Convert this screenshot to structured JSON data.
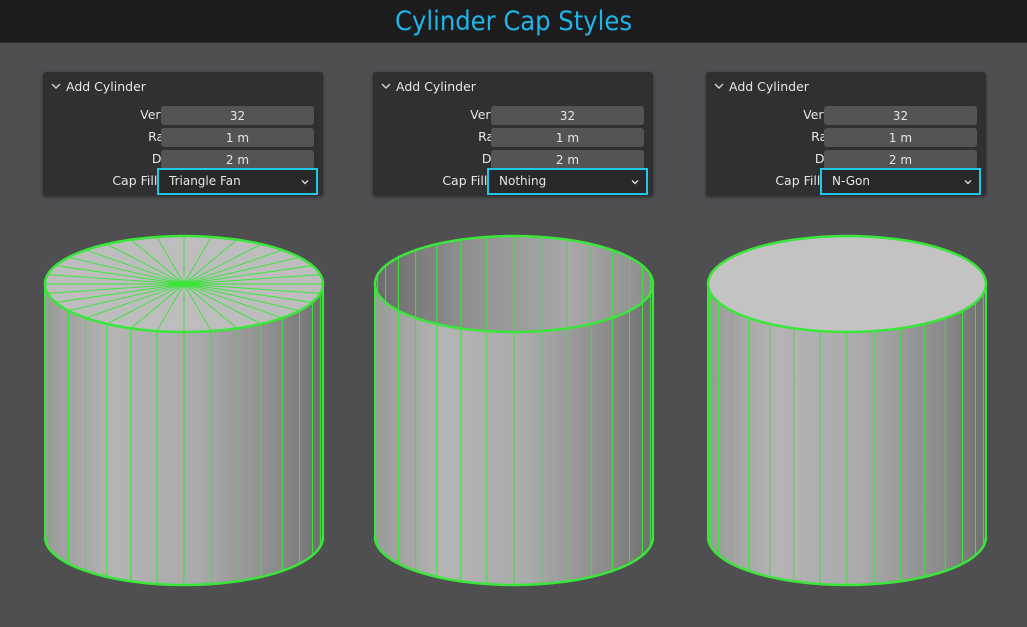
{
  "page": {
    "title": "Cylinder Cap Styles"
  },
  "colors": {
    "title": "#1fb5ea",
    "select_border": "#22c6e6",
    "wire": "#39e639"
  },
  "panels": [
    {
      "header": "Add Cylinder",
      "vertices_label": "Vertices",
      "vertices": "32",
      "radius_label": "Radius",
      "radius": "1 m",
      "depth_label": "Depth",
      "depth": "2 m",
      "cap_label": "Cap Fill Type",
      "cap": "Triangle Fan"
    },
    {
      "header": "Add Cylinder",
      "vertices_label": "Vertices",
      "vertices": "32",
      "radius_label": "Radius",
      "radius": "1 m",
      "depth_label": "Depth",
      "depth": "2 m",
      "cap_label": "Cap Fill Type",
      "cap": "Nothing"
    },
    {
      "header": "Add Cylinder",
      "vertices_label": "Vertices",
      "vertices": "32",
      "radius_label": "Radius",
      "radius": "1 m",
      "depth_label": "Depth",
      "depth": "2 m",
      "cap_label": "Cap Fill Type",
      "cap": "N-Gon"
    }
  ],
  "icons": {
    "collapse": "chevron-down-icon",
    "dropdown": "chevron-down-icon"
  }
}
